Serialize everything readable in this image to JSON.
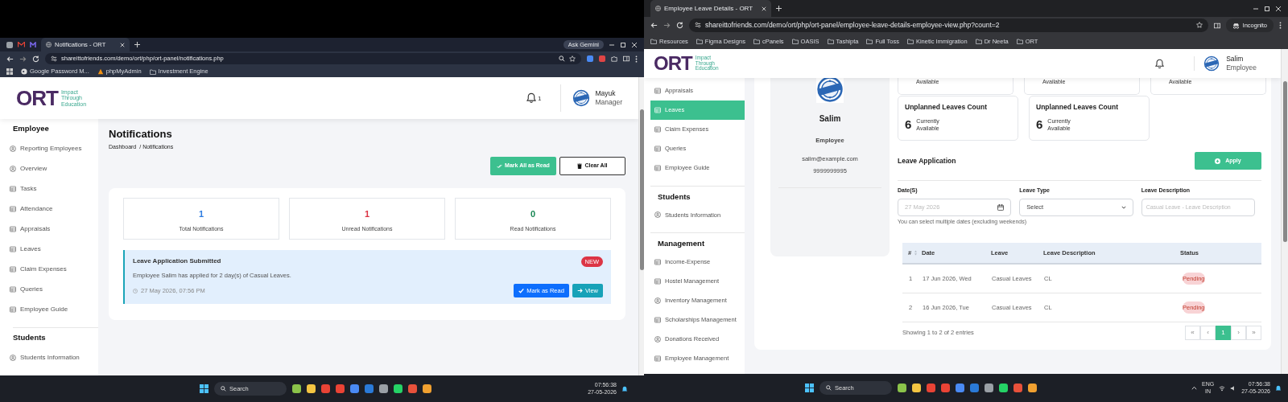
{
  "left_screen": {
    "browser": {
      "tabs": [
        {
          "label": "Notifications - ORT",
          "selected": true
        }
      ],
      "ask_gemini": "Ask Gemini",
      "url": "shareittofriends.com/demo/ort/php/ort-panel/notifications.php",
      "bookmarks": [
        "Google Password M...",
        "phpMyAdmin",
        "Investment Engine"
      ]
    },
    "header": {
      "logo": "ORT",
      "tagline": [
        "Impact",
        "Through",
        "Education"
      ],
      "bell_count": "1",
      "user_name": "Mayuk",
      "user_role": "Manager"
    },
    "sidebar": [
      {
        "heading": "Employee",
        "items": [
          {
            "label": "Reporting Employees",
            "kind": "person",
            "selected": false
          },
          {
            "label": "Overview",
            "kind": "person",
            "selected": false
          },
          {
            "label": "Tasks",
            "kind": "list",
            "selected": false
          },
          {
            "label": "Attendance",
            "kind": "list",
            "selected": false
          },
          {
            "label": "Appraisals",
            "kind": "list",
            "selected": false
          },
          {
            "label": "Leaves",
            "kind": "list",
            "selected": false
          },
          {
            "label": "Claim Expenses",
            "kind": "list",
            "selected": false
          },
          {
            "label": "Queries",
            "kind": "list",
            "selected": false
          },
          {
            "label": "Employee Guide",
            "kind": "list",
            "selected": false
          }
        ]
      },
      {
        "heading": "Students",
        "items": [
          {
            "label": "Students Information",
            "kind": "person",
            "selected": false
          }
        ]
      }
    ],
    "page_title": "Notifications",
    "breadcrumb": [
      "Dashboard",
      "/ Notifications"
    ],
    "actions": [
      {
        "label": "Mark All as Read",
        "kind": "primary"
      },
      {
        "label": "Clear All",
        "kind": "outline"
      }
    ],
    "stats": [
      {
        "value": "1",
        "label": "Total Notifications",
        "color": "#2f7de1"
      },
      {
        "value": "1",
        "label": "Unread Notifications",
        "color": "#dc3545"
      },
      {
        "value": "0",
        "label": "Read Notifications",
        "color": "#198754"
      }
    ],
    "notifications": [
      {
        "title": "Leave Application Submitted",
        "badge": "NEW",
        "unread": true,
        "message": "Employee Salim has applied for 2 day(s) of Casual Leaves.",
        "time": "27 May 2026, 07:56 PM",
        "buttons": [
          {
            "label": "Mark as Read",
            "kind": "check"
          },
          {
            "label": "View",
            "kind": "arrow"
          }
        ]
      }
    ]
  },
  "left_taskbar": {
    "search": "Search",
    "time": "07:56:38",
    "date": "27-05-2026"
  },
  "right_screen": {
    "browser": {
      "tabs": [
        {
          "label": "Employee Leave Details - ORT",
          "selected": true
        }
      ],
      "url": "shareittofriends.com/demo/ort/php/ort-panel/employee-leave-details-employee-view.php?count=2",
      "incognito": "Incognito",
      "bookmarks": [
        "Resources",
        "Figma Designs",
        "cPanels",
        "OASIS",
        "Tashipta",
        "Full Toss",
        "Kinetic Immigration",
        "Dr Neeta",
        "ORT"
      ]
    },
    "header": {
      "logo": "ORT",
      "tagline": [
        "Impact",
        "Through",
        "Education"
      ],
      "user_name": "Salim",
      "user_role": "Employee"
    },
    "sidebar": [
      {
        "items": [
          {
            "label": "Appraisals",
            "kind": "list",
            "selected": false
          },
          {
            "label": "Leaves",
            "kind": "list",
            "selected": true
          },
          {
            "label": "Claim Expenses",
            "kind": "list",
            "selected": false
          },
          {
            "label": "Queries",
            "kind": "list",
            "selected": false
          },
          {
            "label": "Employee Guide",
            "kind": "list",
            "selected": false
          }
        ]
      },
      {
        "heading": "Students",
        "items": [
          {
            "label": "Students Information",
            "kind": "person",
            "selected": false
          }
        ]
      },
      {
        "heading": "Management",
        "items": [
          {
            "label": "Income-Expense",
            "kind": "list",
            "selected": false
          },
          {
            "label": "Hostel Management",
            "kind": "list",
            "selected": false
          },
          {
            "label": "Inventory Management",
            "kind": "person",
            "selected": false
          },
          {
            "label": "Scholarships Management",
            "kind": "list",
            "selected": false
          },
          {
            "label": "Donations Received",
            "kind": "person",
            "selected": false
          },
          {
            "label": "Employee Management",
            "kind": "list",
            "selected": false
          }
        ]
      }
    ],
    "profile": {
      "name": "Salim",
      "role": "Employee",
      "email": "salim@example.com",
      "phone": "9999999995"
    },
    "top_cards": [
      "Available",
      "Available",
      "Available"
    ],
    "leave_cards": [
      {
        "title": "Unplanned Leaves Count",
        "count": "6",
        "note": [
          "Currently",
          "Available"
        ]
      },
      {
        "title": "Unplanned Leaves Count",
        "count": "6",
        "note": [
          "Currently",
          "Available"
        ]
      }
    ],
    "application": {
      "title": "Leave Application",
      "apply": "Apply",
      "fields": [
        {
          "label": "Date(S)",
          "kind": "date",
          "placeholder": "27 May 2026",
          "hint": "You can select multiple dates (excluding weekends)"
        },
        {
          "label": "Leave Type",
          "kind": "select",
          "value": "Select"
        },
        {
          "label": "Leave Description",
          "kind": "text",
          "placeholder": "Casual Leave - Leave Description"
        }
      ]
    },
    "table": {
      "columns": [
        "#",
        "Date",
        "Leave",
        "Leave Description",
        "Status"
      ],
      "rows": [
        {
          "cells": [
            "1",
            "17 Jun 2026, Wed",
            "Casual Leaves",
            "CL"
          ],
          "status": "Pending"
        },
        {
          "cells": [
            "2",
            "16 Jun 2026, Tue",
            "Casual Leaves",
            "CL"
          ],
          "status": "Pending"
        }
      ],
      "summary": "Showing 1 to 2 of 2 entries",
      "pages": [
        {
          "label": "«",
          "selected": false
        },
        {
          "label": "‹",
          "selected": false
        },
        {
          "label": "1",
          "selected": true
        },
        {
          "label": "›",
          "selected": false
        },
        {
          "label": "»",
          "selected": false
        }
      ]
    }
  },
  "right_taskbar": {
    "search": "Search",
    "language": [
      "ENG",
      "IN"
    ],
    "time": "07:56:38",
    "date": "27-05-2026"
  }
}
